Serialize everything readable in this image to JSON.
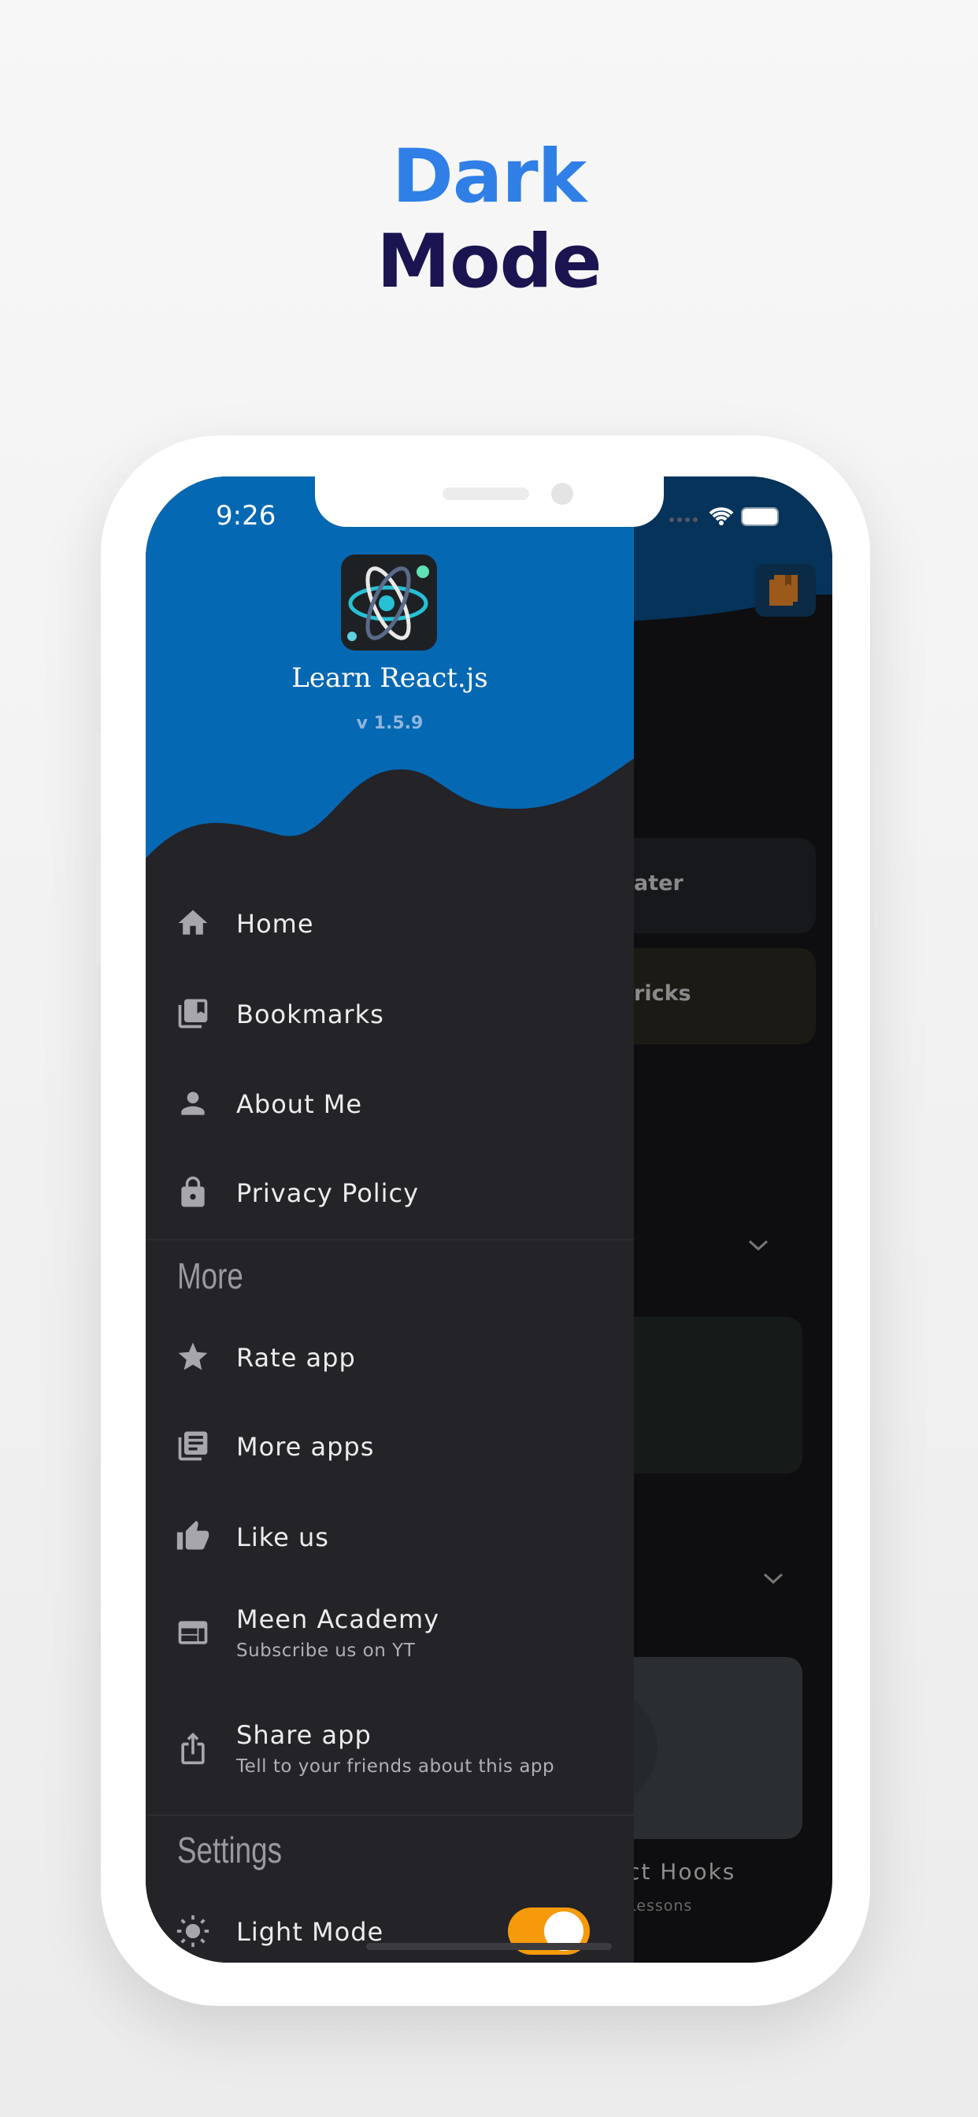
{
  "hero": {
    "line1": "Dark",
    "line2": "Mode"
  },
  "status": {
    "time": "9:26"
  },
  "drawer": {
    "app_name": "Learn React.js",
    "version": "v 1.5.9",
    "items": [
      {
        "label": "Home",
        "icon": "home-icon"
      },
      {
        "label": "Bookmarks",
        "icon": "bookmarks-icon"
      },
      {
        "label": "About Me",
        "icon": "person-icon"
      },
      {
        "label": "Privacy Policy",
        "icon": "lock-icon"
      }
    ],
    "more_heading": "More",
    "more_items": [
      {
        "label": "Rate app",
        "icon": "star-icon"
      },
      {
        "label": "More apps",
        "icon": "library-icon"
      },
      {
        "label": "Like us",
        "icon": "thumbs-up-icon"
      },
      {
        "label": "Meen Academy",
        "sub": "Subscribe us on YT",
        "icon": "web-icon"
      },
      {
        "label": "Share app",
        "sub": "Tell to your friends about this app",
        "icon": "share-icon"
      }
    ],
    "settings_heading": "Settings",
    "light_mode": {
      "label": "Light Mode",
      "icon": "sun-icon",
      "on": true
    }
  },
  "main": {
    "card1_partial": "ater",
    "card2_partial": "ricks",
    "hooks_title_partial": "ct Hooks",
    "hooks_sub_partial": "Lessons"
  },
  "colors": {
    "header_blue": "#0568b3",
    "drawer_bg": "#232328",
    "toggle": "#f59a0a",
    "title_blue": "#2f7fe6",
    "title_navy": "#1a1550"
  }
}
